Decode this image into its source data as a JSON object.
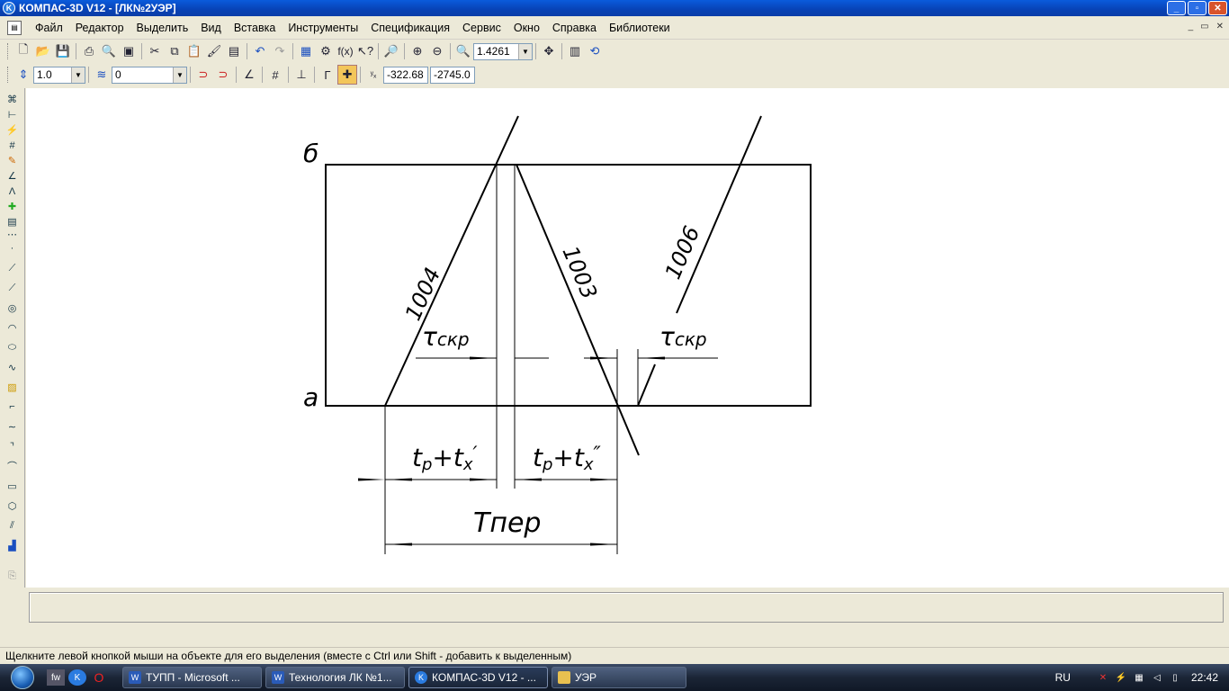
{
  "window": {
    "title": "КОМПАС-3D V12 - [ЛК№2УЭР]",
    "app_icon": "kompas-icon",
    "controls": [
      "minimize",
      "maximize",
      "close"
    ]
  },
  "menu": {
    "items": [
      "Файл",
      "Редактор",
      "Выделить",
      "Вид",
      "Вставка",
      "Инструменты",
      "Спецификация",
      "Сервис",
      "Окно",
      "Справка",
      "Библиотеки"
    ]
  },
  "toolbar1": {
    "zoom_value": "1.4261",
    "fx_label": "f(x)"
  },
  "toolbar2": {
    "step_value": "1.0",
    "layer_value": "0",
    "coord_x": "-322.68",
    "coord_y": "-2745.0"
  },
  "drawing": {
    "label_b": "б",
    "label_a": "а",
    "label_1004": "1004",
    "label_1003": "1003",
    "label_1006": "1006",
    "tau_left": "τ",
    "tau_left_sub": "скр",
    "tau_right": "τ",
    "tau_right_sub": "скр",
    "dim_left_tp": "t",
    "dim_left_p": "р",
    "dim_left_plus": "+",
    "dim_left_tx": "t",
    "dim_left_x": "х",
    "dim_left_prime": "′",
    "dim_right_tp": "t",
    "dim_right_p": "р",
    "dim_right_plus": "+",
    "dim_right_tx": "t",
    "dim_right_x": "х",
    "dim_right_prime": "″",
    "dim_total": "Tпер"
  },
  "status": {
    "text": "Щелкните левой кнопкой мыши на объекте для его выделения (вместе с Ctrl или Shift - добавить к выделенным)"
  },
  "taskbar": {
    "tasks": [
      {
        "label": "ТУПП - Microsoft ...",
        "icon": "word-icon"
      },
      {
        "label": "Технология ЛК №1...",
        "icon": "word-icon"
      },
      {
        "label": "КОМПАС-3D V12 - ...",
        "icon": "kompas-icon"
      },
      {
        "label": "УЭР",
        "icon": "folder-icon"
      }
    ],
    "lang": "RU",
    "clock": "22:42"
  }
}
